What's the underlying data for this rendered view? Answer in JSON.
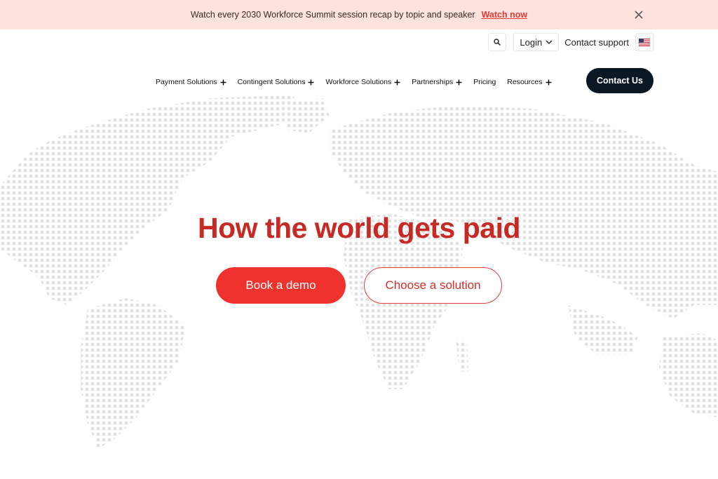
{
  "announcement": {
    "message": "Watch every 2030 Workforce Summit session recap by topic and speaker",
    "link_label": "Watch now"
  },
  "utility": {
    "login_label": "Login",
    "support_label": "Contact support"
  },
  "nav": {
    "items": [
      {
        "label": "Payment Solutions",
        "has_submenu": true
      },
      {
        "label": "Contingent Solutions",
        "has_submenu": true
      },
      {
        "label": "Workforce Solutions",
        "has_submenu": true
      },
      {
        "label": "Partnerships",
        "has_submenu": true
      },
      {
        "label": "Pricing",
        "has_submenu": false
      },
      {
        "label": "Resources",
        "has_submenu": true
      }
    ],
    "cta_label": "Contact Us"
  },
  "hero": {
    "title": "How the world gets paid",
    "primary_cta": "Book a demo",
    "secondary_cta": "Choose a solution"
  },
  "icons": [
    "close-icon",
    "search-icon",
    "chevron-down-icon",
    "us-flag-icon",
    "plus-icon",
    "world-map-dots"
  ],
  "colors": {
    "banner_bg": "#fde2de",
    "accent_red": "#f0322f",
    "title_red": "#c72a25",
    "dark_button": "#0c1724",
    "map_dot": "#e2e2e2"
  }
}
